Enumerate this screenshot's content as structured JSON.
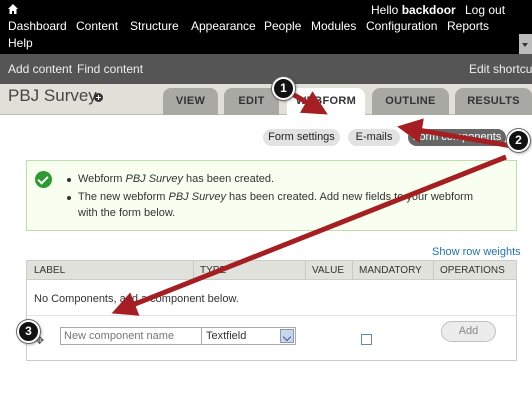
{
  "toolbar": {
    "greeting": "Hello",
    "username": "backdoor",
    "logout": "Log out",
    "menu": [
      "Dashboard",
      "Content",
      "Structure",
      "Appearance",
      "People",
      "Modules",
      "Configuration",
      "Reports",
      "Help"
    ]
  },
  "shortcuts": {
    "add_content": "Add content",
    "find_content": "Find content",
    "edit_shortcuts": "Edit shortcuts"
  },
  "page": {
    "title": "PBJ Survey",
    "tabs": [
      "VIEW",
      "EDIT",
      "WEBFORM",
      "OUTLINE",
      "RESULTS"
    ],
    "active_tab": "WEBFORM"
  },
  "secondary_tabs": [
    "Form settings",
    "E-mails",
    "Form components"
  ],
  "active_secondary_tab": "Form components",
  "status": {
    "line1_pre": "Webform",
    "line1_em": "PBJ Survey",
    "line1_post": "has been created.",
    "line2_pre": "The new webform",
    "line2_em": "PBJ Survey",
    "line2_post": "has been created. Add new fields to your webform",
    "line3": "with the form below."
  },
  "show_row_weights": "Show row weights",
  "table": {
    "columns": [
      "LABEL",
      "TYPE",
      "VALUE",
      "MANDATORY",
      "OPERATIONS"
    ],
    "empty": "No Components, add a component below.",
    "new_component": {
      "placeholder": "New component name",
      "type": "Textfield",
      "mandatory": false,
      "add_button": "Add"
    }
  },
  "callouts": [
    "1",
    "2",
    "3"
  ],
  "colors": {
    "arrow": "#a51f22",
    "success": "#2f9a31",
    "link": "#2473b5",
    "toolbar": "#000000"
  }
}
